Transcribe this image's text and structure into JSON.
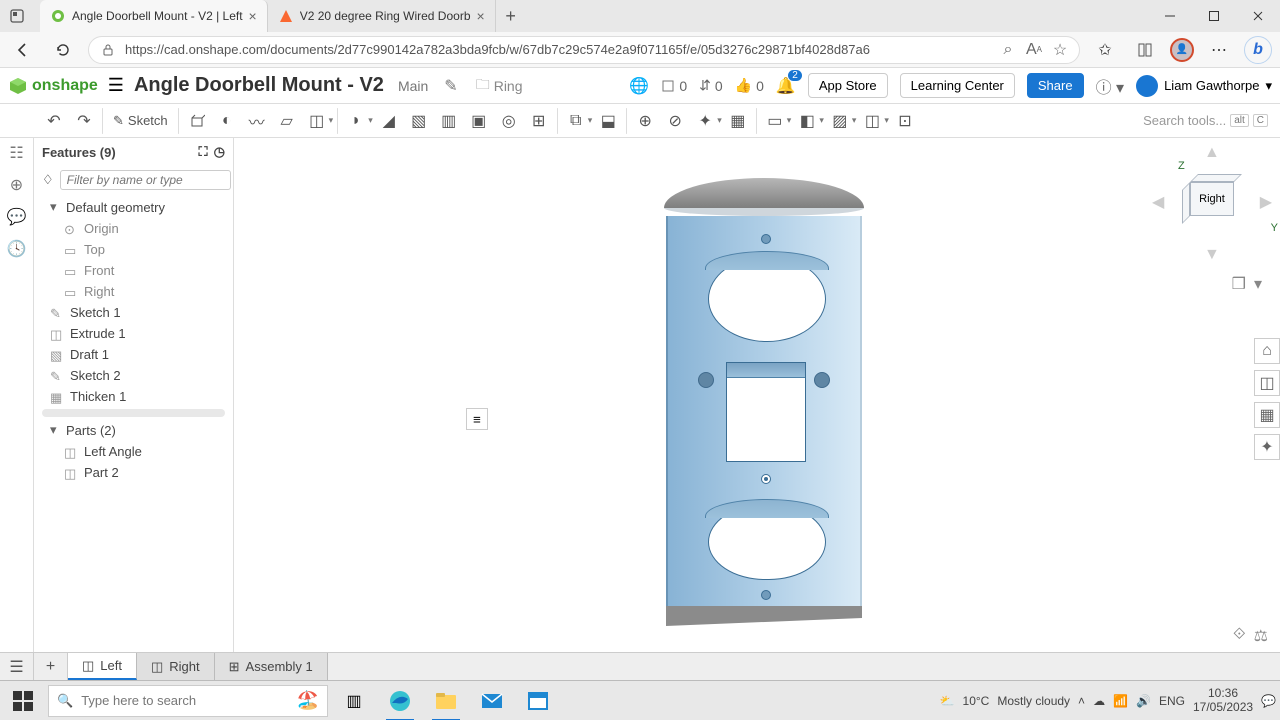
{
  "browser": {
    "tabs": [
      {
        "title": "Angle Doorbell Mount - V2 | Left",
        "active": true,
        "favicon": "onshape"
      },
      {
        "title": "V2 20 degree Ring Wired Doorb",
        "active": false,
        "favicon": "printables"
      }
    ],
    "url": "https://cad.onshape.com/documents/2d77c990142a782a3bda9fcb/w/67db7c29c574e2a9f071165f/e/05d3276c29871bf4028d87a6"
  },
  "header": {
    "logo_text": "onshape",
    "doc_title": "Angle Doorbell Mount - V2",
    "branch": "Main",
    "folder": "Ring",
    "counts": {
      "cube": "0",
      "link": "0",
      "like": "0"
    },
    "notifications": "2",
    "appstore": "App Store",
    "learning": "Learning Center",
    "share": "Share",
    "user_name": "Liam Gawthorpe"
  },
  "toolbar": {
    "sketch": "Sketch",
    "search_placeholder": "Search tools...",
    "shortcut1": "alt",
    "shortcut2": "C"
  },
  "panel": {
    "features_title": "Features (9)",
    "filter_placeholder": "Filter by name or type",
    "default_geometry": "Default geometry",
    "geom": {
      "origin": "Origin",
      "top": "Top",
      "front": "Front",
      "right": "Right"
    },
    "features": [
      "Sketch 1",
      "Extrude 1",
      "Draft 1",
      "Sketch 2",
      "Thicken 1"
    ],
    "parts_title": "Parts (2)",
    "parts": [
      "Left Angle",
      "Part 2"
    ]
  },
  "viewcube": {
    "face": "Right",
    "z": "Z",
    "y": "Y"
  },
  "part_tabs": {
    "add": "+",
    "tabs": [
      "Left",
      "Right",
      "Assembly 1"
    ],
    "active": 0
  },
  "taskbar": {
    "search_placeholder": "Type here to search",
    "weather_temp": "10°C",
    "weather_desc": "Mostly cloudy",
    "lang": "ENG",
    "time": "10:36",
    "date": "17/05/2023"
  }
}
